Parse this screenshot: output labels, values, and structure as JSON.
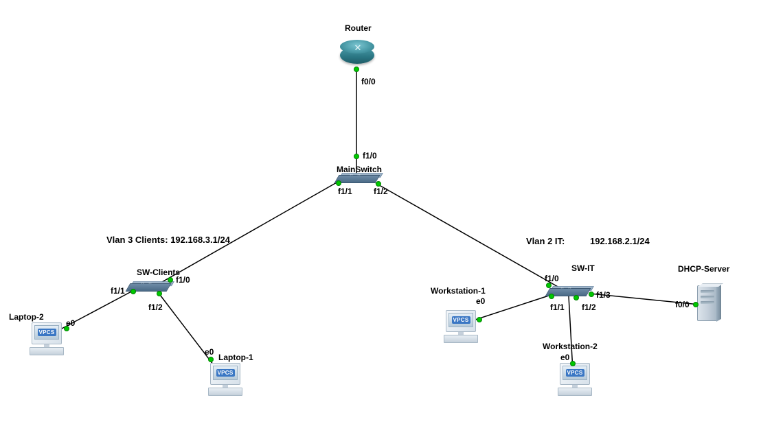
{
  "devices": {
    "router": {
      "label": "Router"
    },
    "mainswitch": {
      "label": "MainSwitch"
    },
    "sw_clients": {
      "label": "SW-Clients"
    },
    "sw_it": {
      "label": "SW-IT"
    },
    "dhcp_server": {
      "label": "DHCP-Server"
    },
    "laptop2": {
      "label": "Laptop-2",
      "badge": "VPCS"
    },
    "laptop1": {
      "label": "Laptop-1",
      "badge": "VPCS"
    },
    "workstation1": {
      "label": "Workstation-1",
      "badge": "VPCS"
    },
    "workstation2": {
      "label": "Workstation-2",
      "badge": "VPCS"
    }
  },
  "vlans": {
    "clients": "Vlan 3 Clients: 192.168.3.1/24",
    "it_a": "Vlan 2 IT:",
    "it_b": "192.168.2.1/24"
  },
  "ports": {
    "router_f00": "f0/0",
    "ms_f10": "f1/0",
    "ms_f11": "f1/1",
    "ms_f12": "f1/2",
    "swc_f10": "f1/0",
    "swc_f11": "f1/1",
    "swc_f12": "f1/2",
    "swit_f10": "f1/0",
    "swit_f11": "f1/1",
    "swit_f12": "f1/2",
    "swit_f13": "f1/3",
    "l2_e0": "e0",
    "l1_e0": "e0",
    "w1_e0": "e0",
    "w2_e0": "e0",
    "dhcp_f00": "f0/0"
  }
}
